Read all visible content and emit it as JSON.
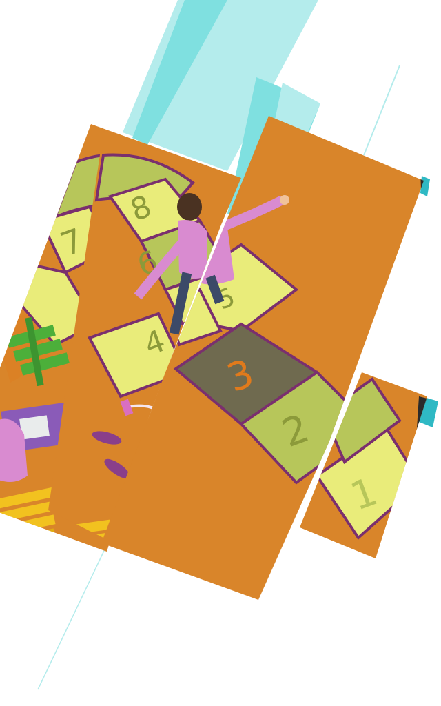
{
  "scene": {
    "subject": "",
    "hopscotch_numbers": [
      "1",
      "2",
      "3",
      "4",
      "5",
      "6",
      "7",
      "8"
    ],
    "colors": {
      "floor": "#d9852a",
      "floor_dark": "#c9741f",
      "tile_yellow": "#e9ec7a",
      "tile_green": "#b7c65a",
      "tile_grey": "#6f6a4f",
      "tile_border": "#7a2f6e",
      "accent_teal": "#7fe0e0",
      "accent_teal_light": "#b4ecec",
      "accent_teal_dark": "#2fb9c4",
      "chair_green": "#4caf3a",
      "chair_purple": "#8a5bb8",
      "chair_yellow": "#f2c21f",
      "shirt_pink": "#d98bd0",
      "number_orange": "#e07a1c",
      "number_dark": "#8c9a3a"
    }
  }
}
